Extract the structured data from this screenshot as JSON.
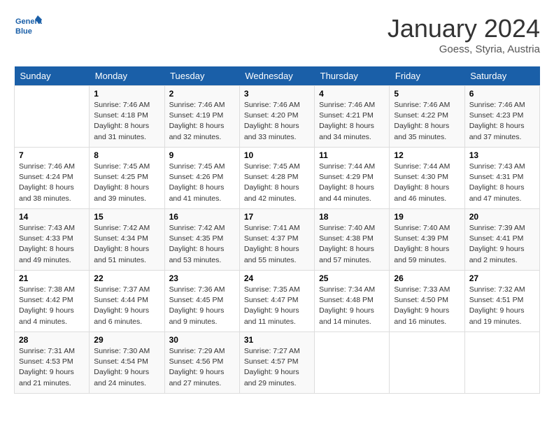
{
  "header": {
    "logo_line1": "General",
    "logo_line2": "Blue",
    "month": "January 2024",
    "location": "Goess, Styria, Austria"
  },
  "weekdays": [
    "Sunday",
    "Monday",
    "Tuesday",
    "Wednesday",
    "Thursday",
    "Friday",
    "Saturday"
  ],
  "weeks": [
    [
      {
        "day": "",
        "content": ""
      },
      {
        "day": "1",
        "content": "Sunrise: 7:46 AM\nSunset: 4:18 PM\nDaylight: 8 hours\nand 31 minutes."
      },
      {
        "day": "2",
        "content": "Sunrise: 7:46 AM\nSunset: 4:19 PM\nDaylight: 8 hours\nand 32 minutes."
      },
      {
        "day": "3",
        "content": "Sunrise: 7:46 AM\nSunset: 4:20 PM\nDaylight: 8 hours\nand 33 minutes."
      },
      {
        "day": "4",
        "content": "Sunrise: 7:46 AM\nSunset: 4:21 PM\nDaylight: 8 hours\nand 34 minutes."
      },
      {
        "day": "5",
        "content": "Sunrise: 7:46 AM\nSunset: 4:22 PM\nDaylight: 8 hours\nand 35 minutes."
      },
      {
        "day": "6",
        "content": "Sunrise: 7:46 AM\nSunset: 4:23 PM\nDaylight: 8 hours\nand 37 minutes."
      }
    ],
    [
      {
        "day": "7",
        "content": "Sunrise: 7:46 AM\nSunset: 4:24 PM\nDaylight: 8 hours\nand 38 minutes."
      },
      {
        "day": "8",
        "content": "Sunrise: 7:45 AM\nSunset: 4:25 PM\nDaylight: 8 hours\nand 39 minutes."
      },
      {
        "day": "9",
        "content": "Sunrise: 7:45 AM\nSunset: 4:26 PM\nDaylight: 8 hours\nand 41 minutes."
      },
      {
        "day": "10",
        "content": "Sunrise: 7:45 AM\nSunset: 4:28 PM\nDaylight: 8 hours\nand 42 minutes."
      },
      {
        "day": "11",
        "content": "Sunrise: 7:44 AM\nSunset: 4:29 PM\nDaylight: 8 hours\nand 44 minutes."
      },
      {
        "day": "12",
        "content": "Sunrise: 7:44 AM\nSunset: 4:30 PM\nDaylight: 8 hours\nand 46 minutes."
      },
      {
        "day": "13",
        "content": "Sunrise: 7:43 AM\nSunset: 4:31 PM\nDaylight: 8 hours\nand 47 minutes."
      }
    ],
    [
      {
        "day": "14",
        "content": "Sunrise: 7:43 AM\nSunset: 4:33 PM\nDaylight: 8 hours\nand 49 minutes."
      },
      {
        "day": "15",
        "content": "Sunrise: 7:42 AM\nSunset: 4:34 PM\nDaylight: 8 hours\nand 51 minutes."
      },
      {
        "day": "16",
        "content": "Sunrise: 7:42 AM\nSunset: 4:35 PM\nDaylight: 8 hours\nand 53 minutes."
      },
      {
        "day": "17",
        "content": "Sunrise: 7:41 AM\nSunset: 4:37 PM\nDaylight: 8 hours\nand 55 minutes."
      },
      {
        "day": "18",
        "content": "Sunrise: 7:40 AM\nSunset: 4:38 PM\nDaylight: 8 hours\nand 57 minutes."
      },
      {
        "day": "19",
        "content": "Sunrise: 7:40 AM\nSunset: 4:39 PM\nDaylight: 8 hours\nand 59 minutes."
      },
      {
        "day": "20",
        "content": "Sunrise: 7:39 AM\nSunset: 4:41 PM\nDaylight: 9 hours\nand 2 minutes."
      }
    ],
    [
      {
        "day": "21",
        "content": "Sunrise: 7:38 AM\nSunset: 4:42 PM\nDaylight: 9 hours\nand 4 minutes."
      },
      {
        "day": "22",
        "content": "Sunrise: 7:37 AM\nSunset: 4:44 PM\nDaylight: 9 hours\nand 6 minutes."
      },
      {
        "day": "23",
        "content": "Sunrise: 7:36 AM\nSunset: 4:45 PM\nDaylight: 9 hours\nand 9 minutes."
      },
      {
        "day": "24",
        "content": "Sunrise: 7:35 AM\nSunset: 4:47 PM\nDaylight: 9 hours\nand 11 minutes."
      },
      {
        "day": "25",
        "content": "Sunrise: 7:34 AM\nSunset: 4:48 PM\nDaylight: 9 hours\nand 14 minutes."
      },
      {
        "day": "26",
        "content": "Sunrise: 7:33 AM\nSunset: 4:50 PM\nDaylight: 9 hours\nand 16 minutes."
      },
      {
        "day": "27",
        "content": "Sunrise: 7:32 AM\nSunset: 4:51 PM\nDaylight: 9 hours\nand 19 minutes."
      }
    ],
    [
      {
        "day": "28",
        "content": "Sunrise: 7:31 AM\nSunset: 4:53 PM\nDaylight: 9 hours\nand 21 minutes."
      },
      {
        "day": "29",
        "content": "Sunrise: 7:30 AM\nSunset: 4:54 PM\nDaylight: 9 hours\nand 24 minutes."
      },
      {
        "day": "30",
        "content": "Sunrise: 7:29 AM\nSunset: 4:56 PM\nDaylight: 9 hours\nand 27 minutes."
      },
      {
        "day": "31",
        "content": "Sunrise: 7:27 AM\nSunset: 4:57 PM\nDaylight: 9 hours\nand 29 minutes."
      },
      {
        "day": "",
        "content": ""
      },
      {
        "day": "",
        "content": ""
      },
      {
        "day": "",
        "content": ""
      }
    ]
  ]
}
